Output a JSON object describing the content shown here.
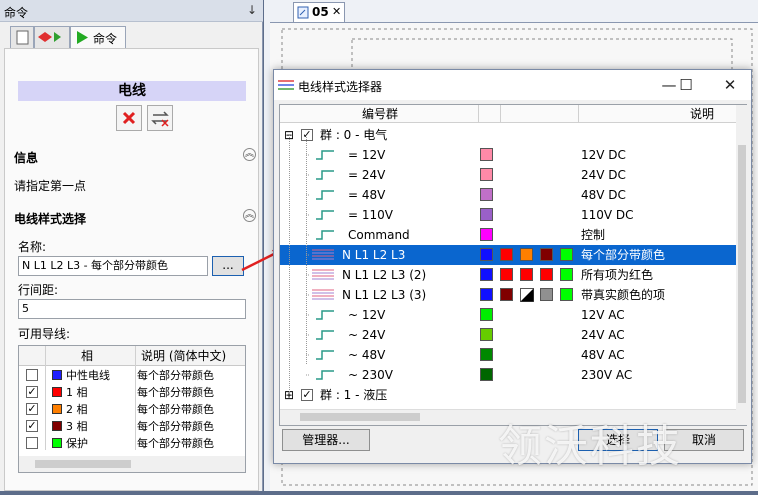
{
  "left_panel": {
    "title": "命令",
    "pin_glyph": "↓",
    "active_tab_label": "命令",
    "heading": "电线",
    "info_section": {
      "title": "信息",
      "text": "请指定第一点"
    },
    "style_section": {
      "title": "电线样式选择",
      "name_label": "名称:",
      "name_value": "N L1 L2 L3 - 每个部分带颜色",
      "browse_label": "...",
      "spacing_label": "行间距:",
      "spacing_value": "5",
      "wires_label": "可用导线:"
    },
    "grid": {
      "columns": [
        "相",
        "说明 (简体中文)"
      ],
      "rows": [
        {
          "checked": false,
          "color": "#1f1fff",
          "phase": "中性电线",
          "desc": "每个部分带颜色"
        },
        {
          "checked": true,
          "color": "#ff0000",
          "phase": "1 相",
          "desc": "每个部分带颜色"
        },
        {
          "checked": true,
          "color": "#ff7f00",
          "phase": "2 相",
          "desc": "每个部分带颜色"
        },
        {
          "checked": true,
          "color": "#800000",
          "phase": "3 相",
          "desc": "每个部分带颜色"
        },
        {
          "checked": false,
          "color": "#00ff00",
          "phase": "保护",
          "desc": "每个部分带颜色"
        }
      ]
    }
  },
  "document_tab": {
    "label": "05",
    "close": "✕"
  },
  "dialog": {
    "title": "电线样式选择器",
    "buttons": {
      "minimize": "—",
      "maximize": "☐",
      "close": "✕"
    },
    "columns": {
      "group": "编号群",
      "description": "说明"
    },
    "groups": [
      {
        "label": "群 : 0 - 电气",
        "expand": "⊟",
        "checked": true
      },
      {
        "label": "群 : 1 - 液压",
        "expand": "⊞",
        "checked": true
      }
    ],
    "styles": [
      {
        "name": "=  12V",
        "type": "single",
        "swatches": [
          "#ff8aa8"
        ],
        "desc": "12V DC",
        "selected": false
      },
      {
        "name": "=  24V",
        "type": "single",
        "swatches": [
          "#ff8aa8"
        ],
        "desc": "24V DC",
        "selected": false
      },
      {
        "name": "=  48V",
        "type": "single",
        "swatches": [
          "#c070c8"
        ],
        "desc": "48V DC",
        "selected": false
      },
      {
        "name": "= 110V",
        "type": "single",
        "swatches": [
          "#9a60c8"
        ],
        "desc": "110V DC",
        "selected": false
      },
      {
        "name": "Command",
        "type": "single",
        "swatches": [
          "#ff00ff"
        ],
        "desc": "控制",
        "selected": false
      },
      {
        "name": "N L1 L2 L3",
        "type": "multi",
        "swatches": [
          "#1010ff",
          "#ff0000",
          "#ff7f00",
          "#800000",
          "#00ff00"
        ],
        "desc": "每个部分带颜色",
        "selected": true
      },
      {
        "name": "N L1 L2 L3 (2)",
        "type": "multi",
        "swatches": [
          "#1010ff",
          "#ff0000",
          "#ff0000",
          "#ff0000",
          "#00ff00"
        ],
        "desc": "所有项为红色",
        "selected": false
      },
      {
        "name": "N L1 L2 L3 (3)",
        "type": "multi",
        "swatches": [
          "#1010ff",
          "#800000",
          "half",
          "#909090",
          "#00ff00"
        ],
        "desc": "带真实颜色的项",
        "selected": false
      },
      {
        "name": "~  12V",
        "type": "single",
        "swatches": [
          "#00ee00"
        ],
        "desc": "12V AC",
        "selected": false
      },
      {
        "name": "~  24V",
        "type": "single",
        "swatches": [
          "#66cc00"
        ],
        "desc": "24V AC",
        "selected": false
      },
      {
        "name": "~  48V",
        "type": "single",
        "swatches": [
          "#008800"
        ],
        "desc": "48V AC",
        "selected": false
      },
      {
        "name": "~ 230V",
        "type": "single",
        "swatches": [
          "#006600"
        ],
        "desc": "230V AC",
        "selected": false
      }
    ],
    "manager_button": "管理器...",
    "select_button": "选择",
    "cancel_button": "取消"
  },
  "watermark": "领沃科技",
  "colors": {
    "selection": "#0a66cf",
    "panel_header": "#d6d4f7",
    "arrow": "#e02020"
  }
}
